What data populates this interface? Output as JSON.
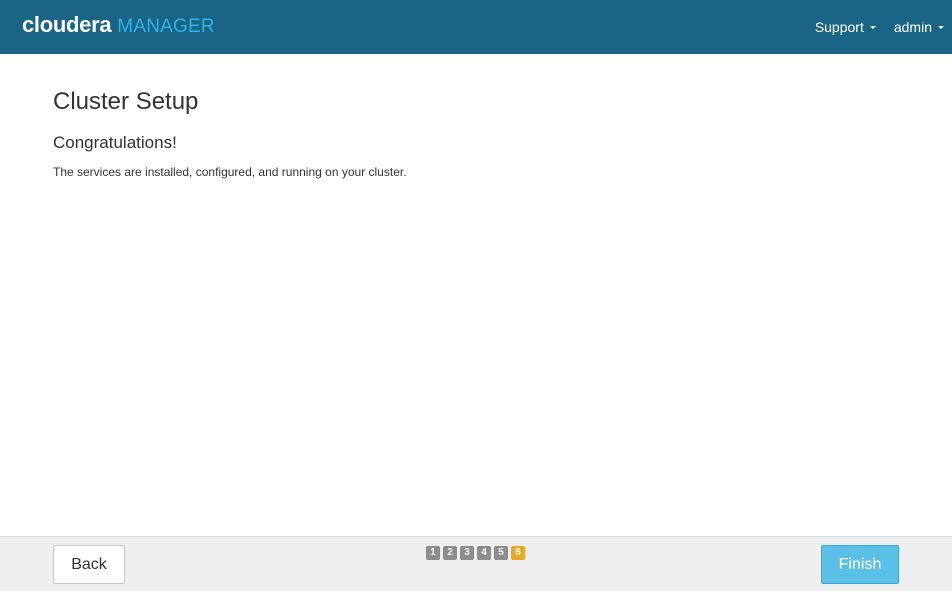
{
  "header": {
    "brand": "cloudera",
    "product": "MANAGER",
    "nav": {
      "support_label": "Support",
      "user_label": "admin"
    }
  },
  "main": {
    "title": "Cluster Setup",
    "heading": "Congratulations!",
    "message": "The services are installed, configured, and running on your cluster."
  },
  "footer": {
    "back_label": "Back",
    "finish_label": "Finish",
    "steps": [
      "1",
      "2",
      "3",
      "4",
      "5",
      "6"
    ],
    "current_step": 6
  },
  "colors": {
    "header_bg": "#1a6586",
    "product_accent": "#2fb3e8",
    "finish_button": "#5bc0e8",
    "current_step": "#e8a925",
    "completed_step": "#8c8c8c"
  },
  "icons": {
    "dropdown": "caret-down-icon"
  }
}
